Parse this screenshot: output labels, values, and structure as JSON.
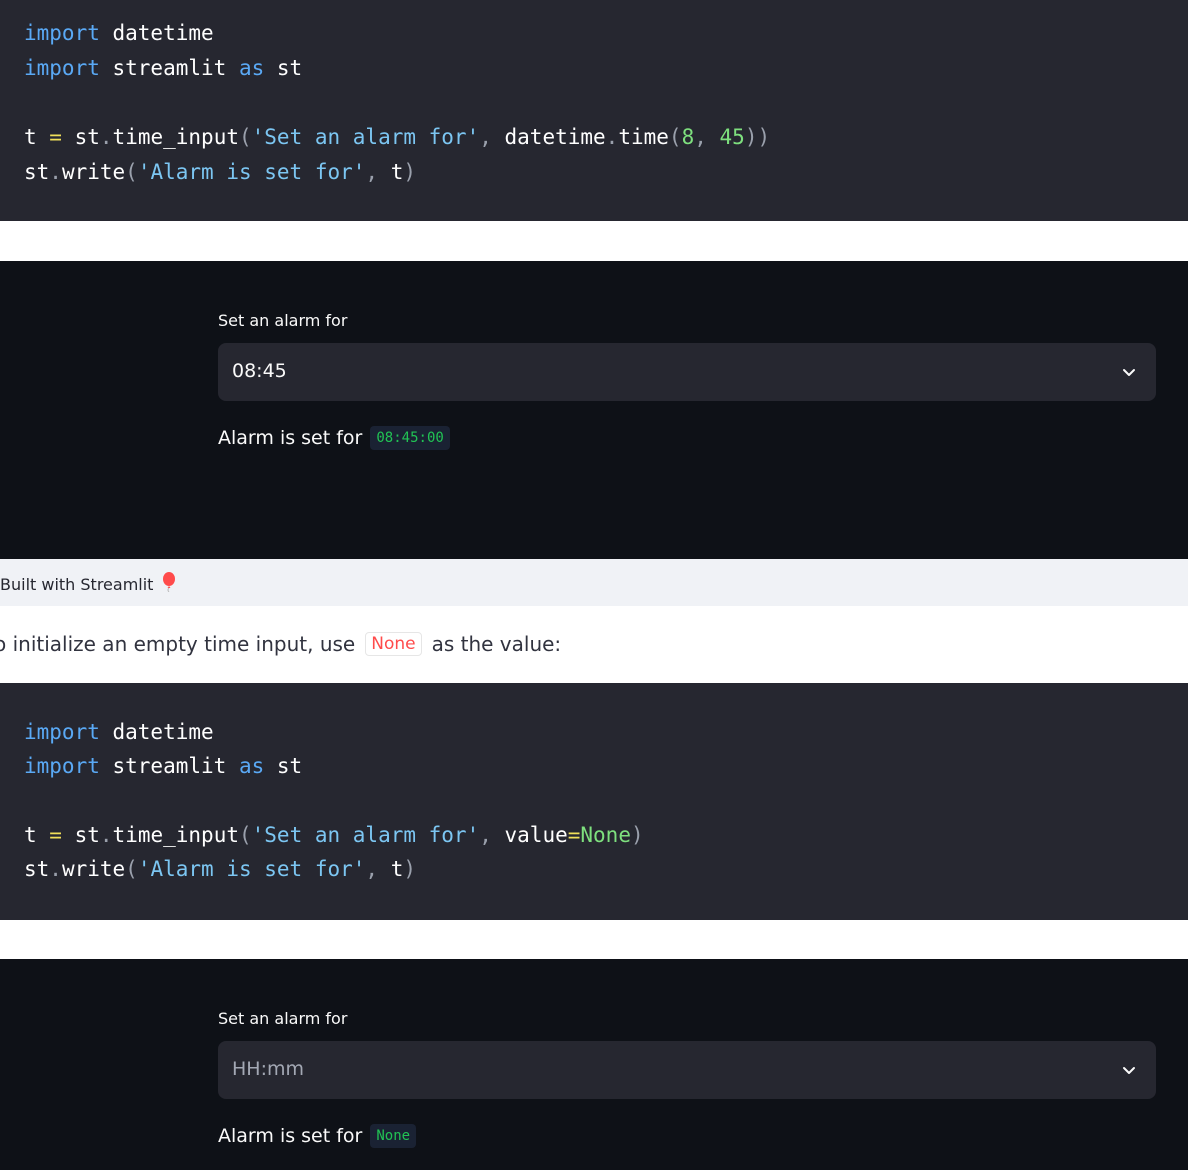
{
  "example1": {
    "code": {
      "line1": {
        "kw": "import",
        "rest": " datetime"
      },
      "line2": {
        "kw1": "import",
        "mid": " streamlit ",
        "kw2": "as",
        "rest": " st"
      },
      "line3": {
        "lhs": "t ",
        "eq": "=",
        "call": " st",
        "dot": ".",
        "fn": "time_input",
        "open": "(",
        "str": "'Set an alarm for'",
        "comma": ", ",
        "obj": "datetime",
        "dot2": ".",
        "fn2": "time",
        "open2": "(",
        "num1": "8",
        "comma2": ", ",
        "num2": "45",
        "close": "))"
      },
      "line4": {
        "obj": "st",
        "dot": ".",
        "fn": "write",
        "open": "(",
        "str": "'Alarm is set for'",
        "comma": ", ",
        "arg": "t",
        "close": ")"
      }
    },
    "app": {
      "label": "Set an alarm for",
      "value": "08:45",
      "write_text": "Alarm is set for",
      "write_value": "08:45:00"
    }
  },
  "footer": {
    "text": "Built with Streamlit",
    "icon": "balloon-icon"
  },
  "prose": {
    "before": "o initialize an empty time input, use",
    "code": "None",
    "after": "as the value:"
  },
  "example2": {
    "code": {
      "line1": {
        "kw": "import",
        "rest": " datetime"
      },
      "line2": {
        "kw1": "import",
        "mid": " streamlit ",
        "kw2": "as",
        "rest": " st"
      },
      "line3": {
        "lhs": "t ",
        "eq": "=",
        "call": " st",
        "dot": ".",
        "fn": "time_input",
        "open": "(",
        "str": "'Set an alarm for'",
        "comma": ", ",
        "kwarg": "value",
        "eq2": "=",
        "none": "None",
        "close": ")"
      },
      "line4": {
        "obj": "st",
        "dot": ".",
        "fn": "write",
        "open": "(",
        "str": "'Alarm is set for'",
        "comma": ", ",
        "arg": "t",
        "close": ")"
      }
    },
    "app": {
      "label": "Set an alarm for",
      "placeholder": "HH:mm",
      "write_text": "Alarm is set for",
      "write_value": "None"
    }
  },
  "colors": {
    "code_bg": "#262730",
    "app_bg": "#0e1117",
    "accent_green": "#21c354",
    "inline_code_red": "#ff4b4b"
  }
}
